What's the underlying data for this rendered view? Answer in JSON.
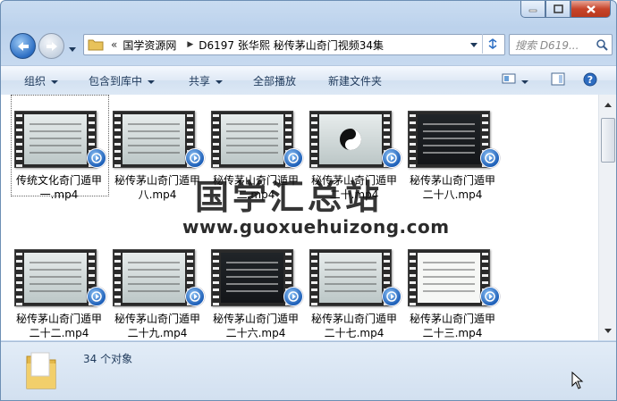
{
  "window": {
    "caption_buttons": [
      "minimize",
      "maximize",
      "close"
    ]
  },
  "nav": {
    "breadcrumbs": [
      "国学资源网",
      "D6197 张华熙 秘传茅山奇门视频34集"
    ],
    "overflow_glyph": "«",
    "search_placeholder": "搜索 D619..."
  },
  "toolbar": {
    "organize": "组织",
    "include_in_library": "包含到库中",
    "share": "共享",
    "play_all": "全部播放",
    "new_folder": "新建文件夹"
  },
  "files": [
    {
      "name": "传统文化奇门遁甲一.mp4",
      "line1": "传统文化奇门遁甲",
      "line2": "一.mp4",
      "thumb": "light"
    },
    {
      "name": "秘传茅山奇门遁甲八.mp4",
      "line1": "秘传茅山奇门遁甲",
      "line2": "八.mp4",
      "thumb": "light"
    },
    {
      "name": "秘传茅山奇门遁甲二.mp4",
      "line1": "秘传茅山奇门遁甲",
      "line2": "二.mp4",
      "thumb": "light"
    },
    {
      "name": "秘传茅山奇门遁甲二十.mp4",
      "line1": "秘传茅山奇门遁甲",
      "line2": "二十.mp4",
      "thumb": "taiji"
    },
    {
      "name": "秘传茅山奇门遁甲二十八.mp4",
      "line1": "秘传茅山奇门遁甲",
      "line2": "二十八.mp4",
      "thumb": "dark"
    },
    {
      "name": "秘传茅山奇门遁甲二十二.mp4",
      "line1": "秘传茅山奇门遁甲",
      "line2": "二十二.mp4",
      "thumb": "light"
    },
    {
      "name": "秘传茅山奇门遁甲二十九.mp4",
      "line1": "秘传茅山奇门遁甲",
      "line2": "二十九.mp4",
      "thumb": "light"
    },
    {
      "name": "秘传茅山奇门遁甲二十六.mp4",
      "line1": "秘传茅山奇门遁甲",
      "line2": "二十六.mp4",
      "thumb": "dark"
    },
    {
      "name": "秘传茅山奇门遁甲二十七.mp4",
      "line1": "秘传茅山奇门遁甲",
      "line2": "二十七.mp4",
      "thumb": "light"
    },
    {
      "name": "秘传茅山奇门遁甲二十三.mp4",
      "line1": "秘传茅山奇门遁甲",
      "line2": "二十三.mp4",
      "thumb": "white"
    }
  ],
  "watermark": {
    "cn": "国学汇总站",
    "url": "www.guoxuehuizong.com"
  },
  "details": {
    "item_count": "34 个对象"
  }
}
